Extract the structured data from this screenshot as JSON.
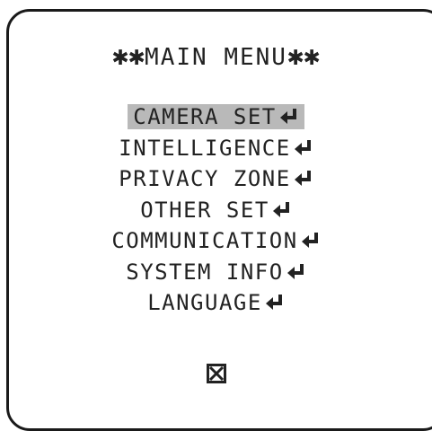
{
  "menu_title": {
    "star_left": "✱✱",
    "text": "MAIN MENU",
    "star_right": "✱✱"
  },
  "menu_items": [
    {
      "label": "CAMERA SET",
      "selected": true
    },
    {
      "label": "INTELLIGENCE",
      "selected": false
    },
    {
      "label": "PRIVACY ZONE",
      "selected": false
    },
    {
      "label": "OTHER SET",
      "selected": false
    },
    {
      "label": "COMMUNICATION",
      "selected": false
    },
    {
      "label": "SYSTEM INFO",
      "selected": false
    },
    {
      "label": "LANGUAGE",
      "selected": false
    }
  ],
  "icons": {
    "submenu": "enter-arrow-icon",
    "exit": "exit-box-icon"
  },
  "colors": {
    "highlight": "#b9b9b9",
    "text": "#222222",
    "border": "#1a1a1a"
  }
}
